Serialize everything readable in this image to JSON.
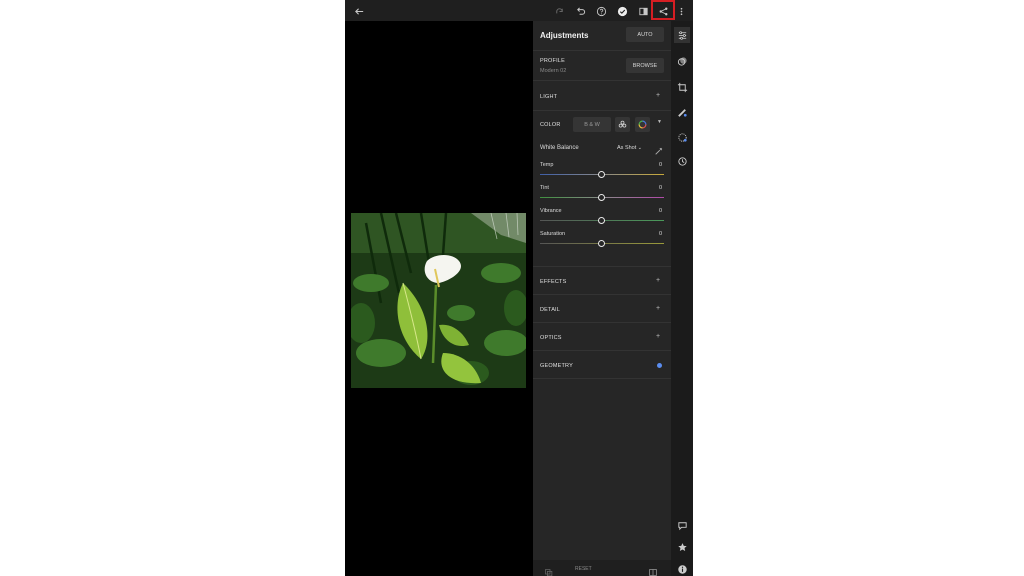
{
  "panel": {
    "title": "Adjustments",
    "auto_label": "AUTO",
    "profile": {
      "label": "PROFILE",
      "value": "Modern 02",
      "browse_label": "BROWSE"
    },
    "light": {
      "label": "LIGHT"
    },
    "color": {
      "label": "COLOR",
      "bw_label": "B & W",
      "white_balance_label": "White Balance",
      "white_balance_value": "As Shot",
      "sliders": [
        {
          "label": "Temp",
          "value": "0"
        },
        {
          "label": "Tint",
          "value": "0"
        },
        {
          "label": "Vibrance",
          "value": "0"
        },
        {
          "label": "Saturation",
          "value": "0"
        }
      ]
    },
    "effects": {
      "label": "EFFECTS"
    },
    "detail": {
      "label": "DETAIL"
    },
    "optics": {
      "label": "OPTICS"
    },
    "geometry": {
      "label": "GEOMETRY"
    },
    "reset_label": "RESET"
  },
  "colors": {
    "accent": "#d51e23",
    "panel_bg": "#262626",
    "geometry_dot": "#5b8def"
  },
  "icons": {
    "topbar": [
      "back-arrow-icon",
      "redo-icon",
      "undo-icon",
      "help-icon",
      "checkmark-icon",
      "compare-icon",
      "share-icon",
      "more-icon"
    ],
    "rail": [
      "adjustments-icon",
      "presets-icon",
      "crop-icon",
      "brush-icon",
      "selective-icon",
      "history-icon",
      "comment-icon",
      "star-icon",
      "info-icon"
    ]
  }
}
